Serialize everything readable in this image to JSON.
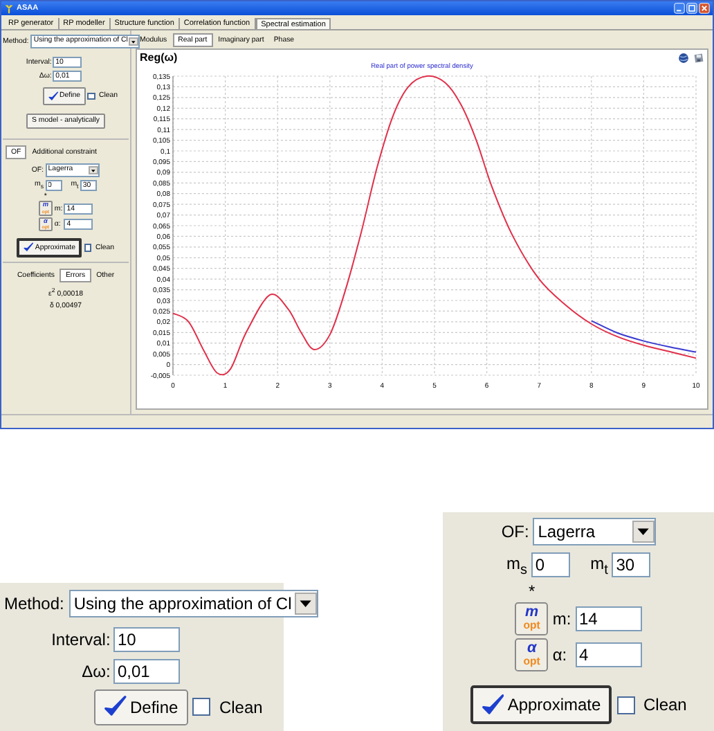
{
  "window": {
    "title": "ASAA"
  },
  "tabs": [
    {
      "label": "RP generator",
      "selected": false
    },
    {
      "label": "RP modeller",
      "selected": false
    },
    {
      "label": "Structure function",
      "selected": false
    },
    {
      "label": "Correlation function",
      "selected": false
    },
    {
      "label": "Spectral estimation",
      "selected": true
    }
  ],
  "left_panel": {
    "method_label": "Method:",
    "method_value": "Using the approximation of Cl",
    "interval_label": "Interval:",
    "interval_value": "10",
    "step_label": "Δω:",
    "step_value": "0,01",
    "define_button": "Define",
    "define_clean": {
      "label": "Clean",
      "checked": false
    },
    "analytic_button": "S model - analytically",
    "constraint_tabs": [
      {
        "label": "OF",
        "selected": true
      },
      {
        "label": "Additional constraint",
        "selected": false
      }
    ],
    "of_label": "OF:",
    "of_value": "Lagerra",
    "ms_label": "m$_{s}$",
    "ms_value": "0",
    "mt_label": "m$_{t}$",
    "mt_value": "30",
    "star": "*",
    "m_opt_button": {
      "symbol": "m",
      "sub": "opt"
    },
    "m_label": "m:",
    "m_value": "14",
    "alpha_opt_button": {
      "symbol": "α",
      "sub": "opt"
    },
    "alpha_label": "α:",
    "alpha_value": "4",
    "approximate_button": "Approximate",
    "approximate_clean": {
      "label": "Clean",
      "checked": false
    },
    "result_tabs": [
      {
        "label": "Coefficients",
        "selected": false
      },
      {
        "label": "Errors",
        "selected": true
      },
      {
        "label": "Other",
        "selected": false
      }
    ],
    "results": [
      "ε$^{2}$ 0,00018",
      "δ 0,00497"
    ]
  },
  "view_tabs": [
    {
      "label": "Modulus",
      "selected": false
    },
    {
      "label": "Real part",
      "selected": true
    },
    {
      "label": "Imaginary part",
      "selected": false
    },
    {
      "label": "Phase",
      "selected": false
    }
  ],
  "chart": {
    "chart_data": {
      "type": "line",
      "title": "Real part of power spectral density",
      "ylabel": "Reg(ω)",
      "x": [
        0,
        0.3,
        0.6,
        0.85,
        1.1,
        1.4,
        1.85,
        2.2,
        2.45,
        2.7,
        3,
        3.3,
        3.6,
        3.9,
        4.2,
        4.5,
        4.85,
        5.2,
        5.5,
        5.8,
        6.1,
        6.5,
        7,
        7.5,
        8,
        8.5,
        9,
        9.5,
        10
      ],
      "series": [
        {
          "color": "#e0304a",
          "values": [
            0.024,
            0.02,
            0.006,
            -0.004,
            -0.002,
            0.015,
            0.0325,
            0.026,
            0.015,
            0.007,
            0.014,
            0.035,
            0.062,
            0.092,
            0.116,
            0.13,
            0.135,
            0.132,
            0.122,
            0.105,
            0.083,
            0.06,
            0.04,
            0.028,
            0.019,
            0.013,
            0.009,
            0.006,
            0.003
          ]
        },
        {
          "color": "#3a3ad0",
          "values": [
            null,
            null,
            null,
            null,
            null,
            null,
            null,
            null,
            null,
            null,
            null,
            null,
            null,
            null,
            null,
            null,
            null,
            null,
            null,
            null,
            null,
            null,
            null,
            null,
            0.0205,
            0.0148,
            0.011,
            0.0082,
            0.0058
          ]
        }
      ],
      "grid": true,
      "xlim": [
        0,
        10
      ],
      "ylim": [
        -0.005,
        0.135
      ],
      "xticks": [
        0,
        1,
        2,
        3,
        4,
        5,
        6,
        7,
        8,
        9,
        10
      ],
      "yticks": [
        {
          "value": 0.135,
          "label": "0,135"
        },
        {
          "value": 0.13,
          "label": "0,13"
        },
        {
          "value": 0.125,
          "label": "0,125"
        },
        {
          "value": 0.12,
          "label": "0,12"
        },
        {
          "value": 0.115,
          "label": "0,115"
        },
        {
          "value": 0.11,
          "label": "0,11"
        },
        {
          "value": 0.105,
          "label": "0,105"
        },
        {
          "value": 0.1,
          "label": "0,1"
        },
        {
          "value": 0.095,
          "label": "0,095"
        },
        {
          "value": 0.09,
          "label": "0,09"
        },
        {
          "value": 0.085,
          "label": "0,085"
        },
        {
          "value": 0.08,
          "label": "0,08"
        },
        {
          "value": 0.075,
          "label": "0,075"
        },
        {
          "value": 0.07,
          "label": "0,07"
        },
        {
          "value": 0.065,
          "label": "0,065"
        },
        {
          "value": 0.06,
          "label": "0,06"
        },
        {
          "value": 0.055,
          "label": "0,055"
        },
        {
          "value": 0.05,
          "label": "0,05"
        },
        {
          "value": 0.045,
          "label": "0,045"
        },
        {
          "value": 0.04,
          "label": "0,04"
        },
        {
          "value": 0.035,
          "label": "0,035"
        },
        {
          "value": 0.03,
          "label": "0,03"
        },
        {
          "value": 0.025,
          "label": "0,025"
        },
        {
          "value": 0.02,
          "label": "0,02"
        },
        {
          "value": 0.015,
          "label": "0,015"
        },
        {
          "value": 0.01,
          "label": "0,01"
        },
        {
          "value": 0.005,
          "label": "0,005"
        },
        {
          "value": 0,
          "label": "0"
        },
        {
          "value": -0.005,
          "label": "-0,005"
        }
      ]
    }
  },
  "method_inset": {
    "method_label": "Method:",
    "method_value": "Using the approximation of Cl",
    "interval_label": "Interval:",
    "interval_value": "10",
    "step_label": "Δω:",
    "step_value": "0,01",
    "define_button": "Define",
    "define_clean": {
      "label": "Clean",
      "checked": false
    }
  },
  "approximation_inset": {
    "of_label": "OF:",
    "of_value": "Lagerra",
    "ms_label": "m$_{s}$",
    "ms_value": "0",
    "mt_label": "m$_{t}$",
    "mt_value": "30",
    "star": "*",
    "m_opt_button": {
      "symbol": "m",
      "sub": "opt"
    },
    "m_label": "m:",
    "m_value": "14",
    "alpha_opt_button": {
      "symbol": "α",
      "sub": "opt"
    },
    "alpha_label": "α:",
    "alpha_value": "4",
    "approximate_button": "Approximate",
    "approximate_clean": {
      "label": "Clean",
      "checked": false
    }
  }
}
